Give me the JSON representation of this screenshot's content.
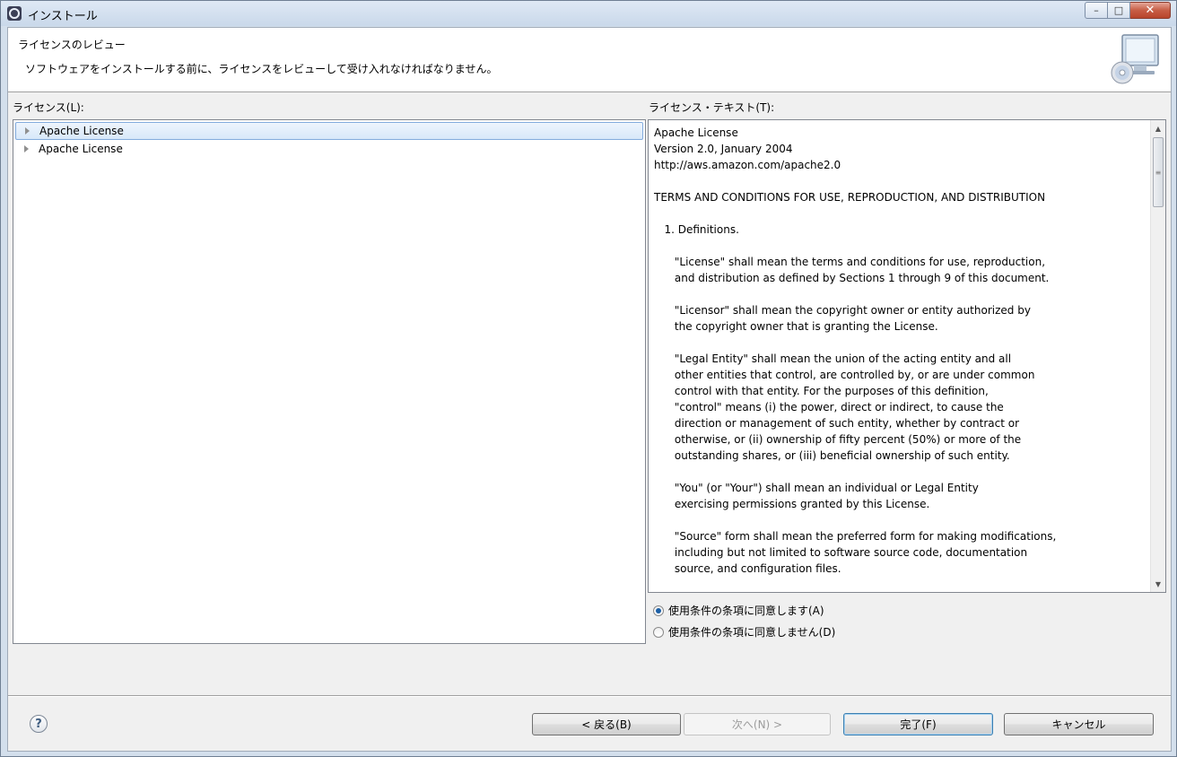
{
  "window": {
    "title": "インストール"
  },
  "banner": {
    "title": "ライセンスのレビュー",
    "description": "ソフトウェアをインストールする前に、ライセンスをレビューして受け入れなければなりません。"
  },
  "licenses": {
    "label": "ライセンス(L):",
    "items": [
      {
        "label": "Apache License",
        "selected": true
      },
      {
        "label": "Apache License",
        "selected": false
      }
    ]
  },
  "license_text": {
    "label": "ライセンス・テキスト(T):",
    "lines": [
      "Apache License",
      "Version 2.0, January 2004",
      "http://aws.amazon.com/apache2.0",
      "",
      "TERMS AND CONDITIONS FOR USE, REPRODUCTION, AND DISTRIBUTION",
      "",
      "   1. Definitions.",
      "",
      "      \"License\" shall mean the terms and conditions for use, reproduction,",
      "      and distribution as defined by Sections 1 through 9 of this document.",
      "",
      "      \"Licensor\" shall mean the copyright owner or entity authorized by",
      "      the copyright owner that is granting the License.",
      "",
      "      \"Legal Entity\" shall mean the union of the acting entity and all",
      "      other entities that control, are controlled by, or are under common",
      "      control with that entity. For the purposes of this definition,",
      "      \"control\" means (i) the power, direct or indirect, to cause the",
      "      direction or management of such entity, whether by contract or",
      "      otherwise, or (ii) ownership of fifty percent (50%) or more of the",
      "      outstanding shares, or (iii) beneficial ownership of such entity.",
      "",
      "      \"You\" (or \"Your\") shall mean an individual or Legal Entity",
      "      exercising permissions granted by this License.",
      "",
      "      \"Source\" form shall mean the preferred form for making modifications,",
      "      including but not limited to software source code, documentation",
      "      source, and configuration files."
    ]
  },
  "agreement": {
    "accept_label": "使用条件の条項に同意します(A)",
    "decline_label": "使用条件の条項に同意しません(D)",
    "selected": "accept"
  },
  "buttons": {
    "back": "< 戻る(B)",
    "next": "次へ(N) >",
    "finish": "完了(F)",
    "cancel": "キャンセル"
  },
  "icons": {
    "help": "?",
    "minimize": "–",
    "maximize": "□",
    "close": "✕"
  }
}
